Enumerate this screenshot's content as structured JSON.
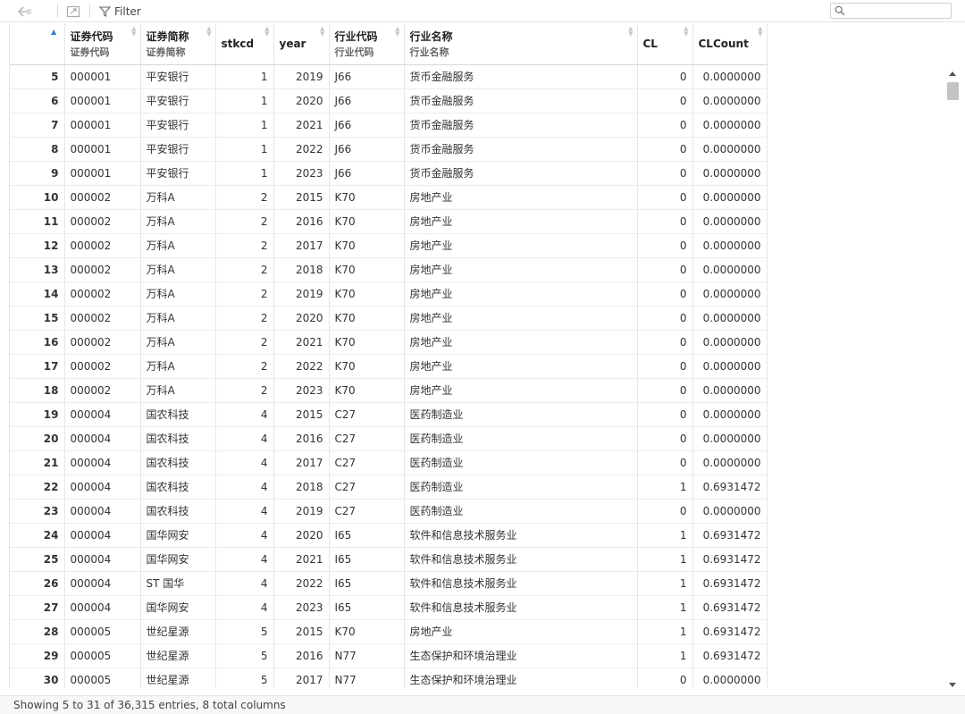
{
  "toolbar": {
    "filter_label": "Filter",
    "search_placeholder": ""
  },
  "columns": [
    {
      "key": "rownum",
      "title": "",
      "subtitle": ""
    },
    {
      "key": "code",
      "title": "证券代码",
      "subtitle": "证券代码"
    },
    {
      "key": "name",
      "title": "证券简称",
      "subtitle": "证券简称"
    },
    {
      "key": "stkcd",
      "title": "stkcd",
      "subtitle": ""
    },
    {
      "key": "year",
      "title": "year",
      "subtitle": ""
    },
    {
      "key": "ind_code",
      "title": "行业代码",
      "subtitle": "行业代码"
    },
    {
      "key": "ind_name",
      "title": "行业名称",
      "subtitle": "行业名称"
    },
    {
      "key": "cl",
      "title": "CL",
      "subtitle": ""
    },
    {
      "key": "clcount",
      "title": "CLCount",
      "subtitle": ""
    }
  ],
  "rows": [
    [
      "5",
      "000001",
      "平安银行",
      "1",
      "2019",
      "J66",
      "货币金融服务",
      "0",
      "0.0000000"
    ],
    [
      "6",
      "000001",
      "平安银行",
      "1",
      "2020",
      "J66",
      "货币金融服务",
      "0",
      "0.0000000"
    ],
    [
      "7",
      "000001",
      "平安银行",
      "1",
      "2021",
      "J66",
      "货币金融服务",
      "0",
      "0.0000000"
    ],
    [
      "8",
      "000001",
      "平安银行",
      "1",
      "2022",
      "J66",
      "货币金融服务",
      "0",
      "0.0000000"
    ],
    [
      "9",
      "000001",
      "平安银行",
      "1",
      "2023",
      "J66",
      "货币金融服务",
      "0",
      "0.0000000"
    ],
    [
      "10",
      "000002",
      "万科A",
      "2",
      "2015",
      "K70",
      "房地产业",
      "0",
      "0.0000000"
    ],
    [
      "11",
      "000002",
      "万科A",
      "2",
      "2016",
      "K70",
      "房地产业",
      "0",
      "0.0000000"
    ],
    [
      "12",
      "000002",
      "万科A",
      "2",
      "2017",
      "K70",
      "房地产业",
      "0",
      "0.0000000"
    ],
    [
      "13",
      "000002",
      "万科A",
      "2",
      "2018",
      "K70",
      "房地产业",
      "0",
      "0.0000000"
    ],
    [
      "14",
      "000002",
      "万科A",
      "2",
      "2019",
      "K70",
      "房地产业",
      "0",
      "0.0000000"
    ],
    [
      "15",
      "000002",
      "万科A",
      "2",
      "2020",
      "K70",
      "房地产业",
      "0",
      "0.0000000"
    ],
    [
      "16",
      "000002",
      "万科A",
      "2",
      "2021",
      "K70",
      "房地产业",
      "0",
      "0.0000000"
    ],
    [
      "17",
      "000002",
      "万科A",
      "2",
      "2022",
      "K70",
      "房地产业",
      "0",
      "0.0000000"
    ],
    [
      "18",
      "000002",
      "万科A",
      "2",
      "2023",
      "K70",
      "房地产业",
      "0",
      "0.0000000"
    ],
    [
      "19",
      "000004",
      "国农科技",
      "4",
      "2015",
      "C27",
      "医药制造业",
      "0",
      "0.0000000"
    ],
    [
      "20",
      "000004",
      "国农科技",
      "4",
      "2016",
      "C27",
      "医药制造业",
      "0",
      "0.0000000"
    ],
    [
      "21",
      "000004",
      "国农科技",
      "4",
      "2017",
      "C27",
      "医药制造业",
      "0",
      "0.0000000"
    ],
    [
      "22",
      "000004",
      "国农科技",
      "4",
      "2018",
      "C27",
      "医药制造业",
      "1",
      "0.6931472"
    ],
    [
      "23",
      "000004",
      "国农科技",
      "4",
      "2019",
      "C27",
      "医药制造业",
      "0",
      "0.0000000"
    ],
    [
      "24",
      "000004",
      "国华网安",
      "4",
      "2020",
      "I65",
      "软件和信息技术服务业",
      "1",
      "0.6931472"
    ],
    [
      "25",
      "000004",
      "国华网安",
      "4",
      "2021",
      "I65",
      "软件和信息技术服务业",
      "1",
      "0.6931472"
    ],
    [
      "26",
      "000004",
      "ST 国华",
      "4",
      "2022",
      "I65",
      "软件和信息技术服务业",
      "1",
      "0.6931472"
    ],
    [
      "27",
      "000004",
      "国华网安",
      "4",
      "2023",
      "I65",
      "软件和信息技术服务业",
      "1",
      "0.6931472"
    ],
    [
      "28",
      "000005",
      "世纪星源",
      "5",
      "2015",
      "K70",
      "房地产业",
      "1",
      "0.6931472"
    ],
    [
      "29",
      "000005",
      "世纪星源",
      "5",
      "2016",
      "N77",
      "生态保护和环境治理业",
      "1",
      "0.6931472"
    ],
    [
      "30",
      "000005",
      "世纪星源",
      "5",
      "2017",
      "N77",
      "生态保护和环境治理业",
      "0",
      "0.0000000"
    ]
  ],
  "status": {
    "text": "Showing 5 to 31 of 36,315 entries, 8 total columns"
  }
}
